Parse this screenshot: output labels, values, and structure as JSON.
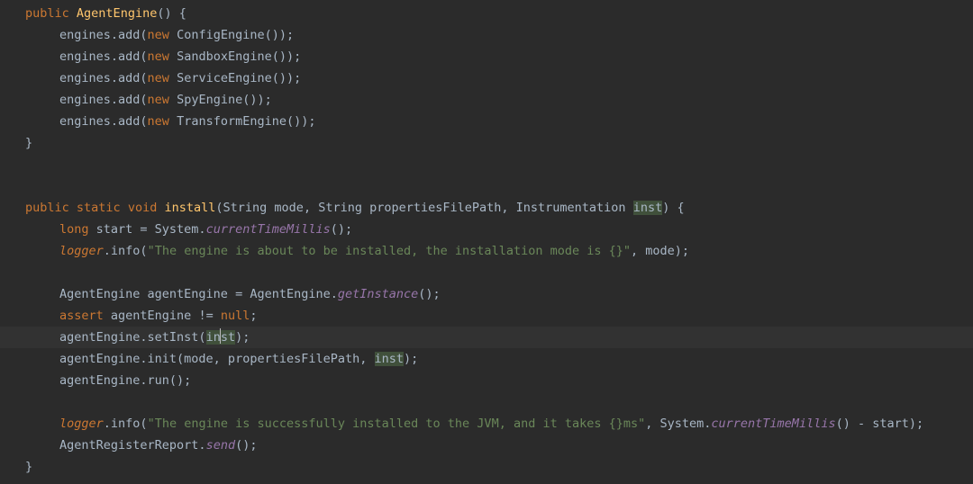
{
  "code": {
    "ctor": {
      "sig_pub": "public",
      "sig_name": "AgentEngine",
      "sig_tail": "() {",
      "add1a": "engines.add(",
      "add_new": "new",
      "e1": " ConfigEngine());",
      "e2": " SandboxEngine());",
      "e3": " ServiceEngine());",
      "e4": " SpyEngine());",
      "e5": " TransformEngine());",
      "close": "}"
    },
    "install": {
      "sig_pub": "public",
      "sig_static": "static",
      "sig_void": "void",
      "sig_name": "install",
      "sig_p1": "(String mode, String propertiesFilePath, Instrumentation ",
      "sig_inst": "inst",
      "sig_p2": ") {",
      "l1_long": "long",
      "l1_rest": " start = System.",
      "l1_m": "currentTimeMillis",
      "l1_end": "();",
      "logger": "logger",
      "l2_a": ".info(",
      "l2_s": "\"The engine is about to be installed, the installation mode is {}\"",
      "l2_b": ", mode);",
      "l3": "AgentEngine agentEngine = AgentEngine.",
      "l3_m": "getInstance",
      "l3_end": "();",
      "l4_assert": "assert",
      "l4_rest": " agentEngine != ",
      "l4_null": "null",
      "l4_end": ";",
      "l5a": "agentEngine.setInst(",
      "l5_in": "in",
      "l5_st": "st",
      "l5b": ");",
      "l6a": "agentEngine.init(mode, propertiesFilePath, ",
      "l6_inst": "inst",
      "l6b": ");",
      "l7": "agentEngine.run();",
      "l8_a": ".info(",
      "l8_s": "\"The engine is successfully installed to the JVM, and it takes {}ms\"",
      "l8_b": ", System.",
      "l8_m": "currentTimeMillis",
      "l8_c": "() - start);",
      "l9a": "AgentRegisterReport.",
      "l9_m": "send",
      "l9b": "();",
      "close": "}"
    }
  }
}
